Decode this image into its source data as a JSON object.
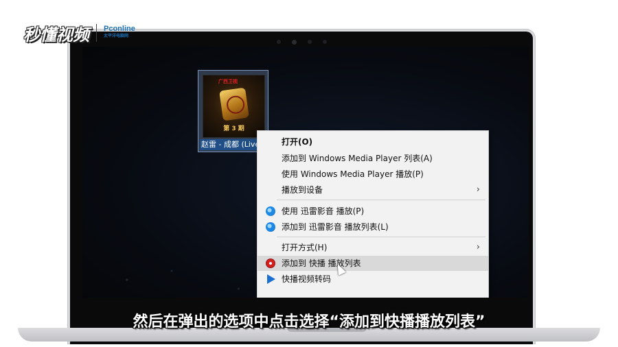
{
  "watermark": {
    "brand": "秒懂视频",
    "partner": "Pconline",
    "partner_sub": "太平洋电脑网"
  },
  "desktop": {
    "file_icon": {
      "label": "赵雷 - 成都 (Live)",
      "thumbnail": {
        "badge": "广西卫视",
        "episode": "第 3 期"
      }
    }
  },
  "context_menu": {
    "items": [
      {
        "label": "打开(O)",
        "bold": true
      },
      {
        "label": "添加到 Windows Media Player 列表(A)"
      },
      {
        "label": "使用 Windows Media Player 播放(P)"
      },
      {
        "label": "播放到设备",
        "submenu": true
      },
      {
        "label": "使用 迅雷影音 播放(P)",
        "icon": "xunlei-icon"
      },
      {
        "label": "添加到 迅雷影音 播放列表(L)",
        "icon": "xunlei-icon"
      },
      {
        "label": "打开方式(H)",
        "submenu": true
      },
      {
        "label": "添加到 快播 播放列表",
        "icon": "kuaibo-icon",
        "highlighted": true
      },
      {
        "label": "快播视频转码",
        "icon": "kuaibo-transcode-icon"
      }
    ],
    "arrow_glyph": "›"
  },
  "subtitle": "然后在弹出的选项中点击选择“添加到快播播放列表”",
  "colors": {
    "menu_bg": "#f2f2f2",
    "menu_hover": "#d9d9d9",
    "selection_label": "#1f4f86",
    "laptop_body": "#d9dadc"
  }
}
